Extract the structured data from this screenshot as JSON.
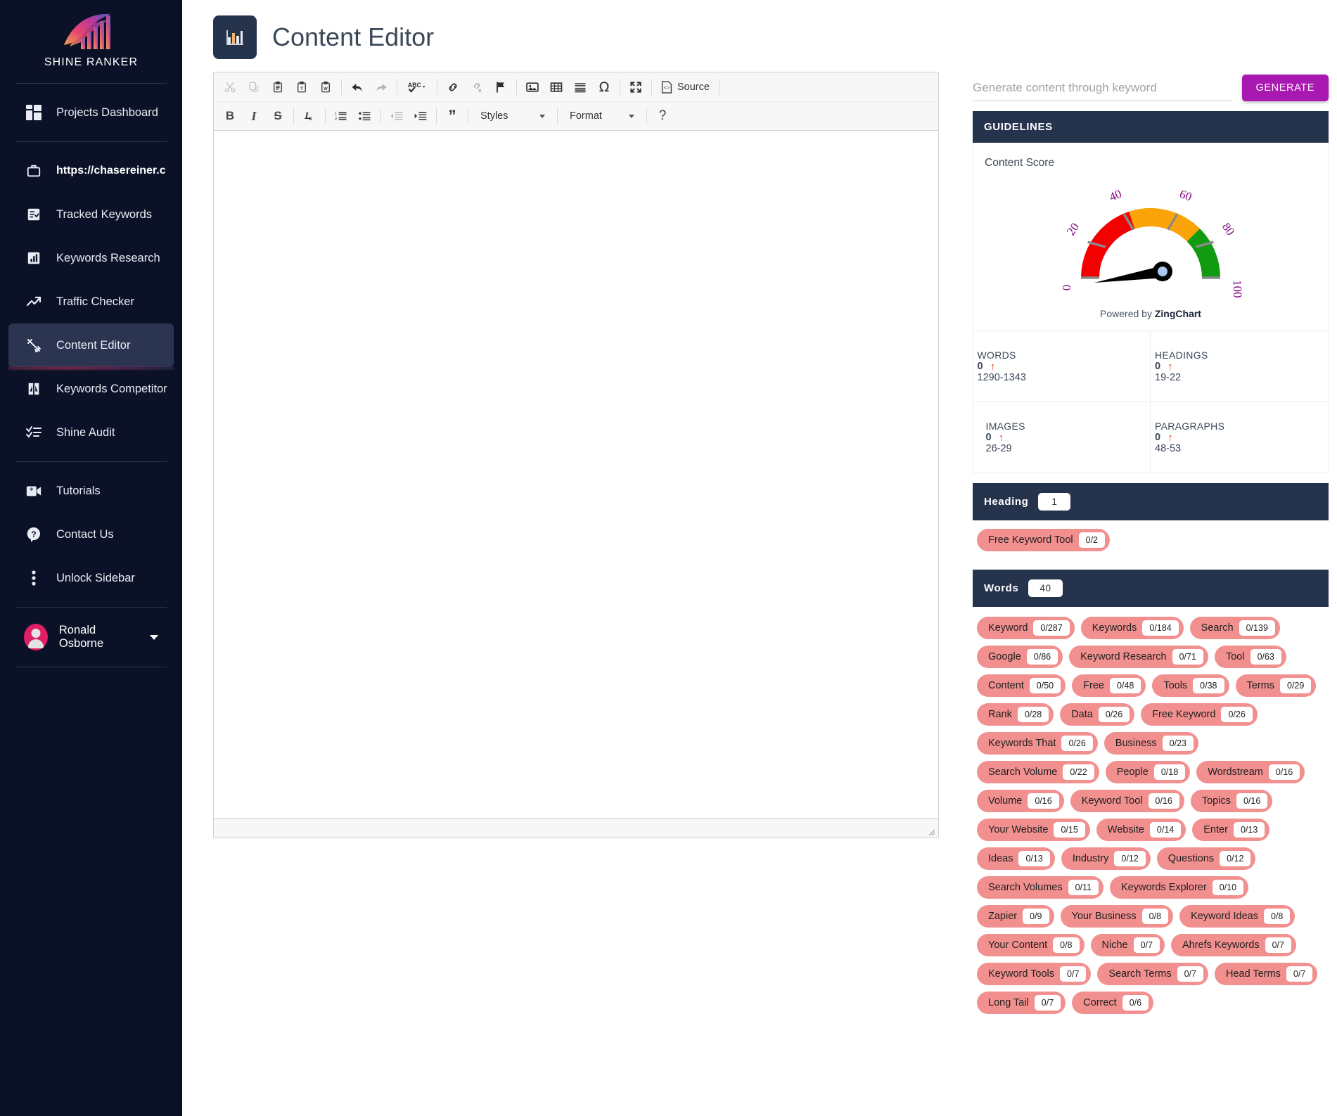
{
  "brand": {
    "name": "SHINE RANKER",
    "logo_icon": "shine-ranker-logo"
  },
  "sidebar": {
    "items": [
      {
        "label": "Projects Dashboard",
        "icon": "dashboard-grid-icon",
        "active": false,
        "bold": false
      },
      {
        "label": "https://chasereiner.c",
        "icon": "briefcase-icon",
        "active": false,
        "bold": true
      },
      {
        "label": "Tracked Keywords",
        "icon": "checklist-icon",
        "active": false,
        "bold": false
      },
      {
        "label": "Keywords Research",
        "icon": "bar-chart-icon",
        "active": false,
        "bold": false
      },
      {
        "label": "Traffic Checker",
        "icon": "trending-up-icon",
        "active": false,
        "bold": false
      },
      {
        "label": "Content Editor",
        "icon": "content-editor-icon",
        "active": true,
        "bold": false
      },
      {
        "label": "Keywords Competitor",
        "icon": "competitor-icon",
        "active": false,
        "bold": false
      },
      {
        "label": "Shine Audit",
        "icon": "audit-checklist-icon",
        "active": false,
        "bold": false
      },
      {
        "label": "Tutorials",
        "icon": "video-icon",
        "active": false,
        "bold": false
      },
      {
        "label": "Contact Us",
        "icon": "question-circle-icon",
        "active": false,
        "bold": false
      },
      {
        "label": "Unlock Sidebar",
        "icon": "dots-vertical-icon",
        "active": false,
        "bold": false
      }
    ],
    "user": {
      "name": "Ronald Osborne",
      "avatar_icon": "user-avatar",
      "caret_icon": "chevron-down-icon",
      "avatar_color": "#e01e63"
    }
  },
  "header": {
    "title": "Content Editor",
    "icon": "bar-chart-page-icon"
  },
  "editor": {
    "toolbar_row1": [
      {
        "name": "cut",
        "glyph": "✂",
        "disabled": true
      },
      {
        "name": "copy",
        "glyph": "copy",
        "disabled": true
      },
      {
        "name": "paste",
        "glyph": "paste",
        "disabled": false
      },
      {
        "name": "paste-as-plain-text",
        "glyph": "paste-text",
        "disabled": false
      },
      {
        "name": "paste-from-word",
        "glyph": "paste-word",
        "disabled": false
      },
      {
        "name": "sep",
        "glyph": "",
        "disabled": false
      },
      {
        "name": "undo",
        "glyph": "undo",
        "disabled": false
      },
      {
        "name": "redo",
        "glyph": "redo",
        "disabled": true
      },
      {
        "name": "sep",
        "glyph": "",
        "disabled": false
      },
      {
        "name": "spell-check",
        "glyph": "abc-check",
        "disabled": false
      },
      {
        "name": "sep",
        "glyph": "",
        "disabled": false
      },
      {
        "name": "link",
        "glyph": "link",
        "disabled": false
      },
      {
        "name": "unlink",
        "glyph": "unlink",
        "disabled": true
      },
      {
        "name": "anchor",
        "glyph": "flag",
        "disabled": false
      },
      {
        "name": "sep",
        "glyph": "",
        "disabled": false
      },
      {
        "name": "image",
        "glyph": "image",
        "disabled": false
      },
      {
        "name": "table",
        "glyph": "table",
        "disabled": false
      },
      {
        "name": "horizontal-rule",
        "glyph": "hrule",
        "disabled": false
      },
      {
        "name": "special-character",
        "glyph": "Ω",
        "disabled": false
      },
      {
        "name": "sep",
        "glyph": "",
        "disabled": false
      },
      {
        "name": "maximize",
        "glyph": "maximize",
        "disabled": false
      }
    ],
    "source_label": "Source",
    "toolbar_row2": [
      {
        "name": "bold",
        "glyph": "B",
        "disabled": false
      },
      {
        "name": "italic",
        "glyph": "I",
        "disabled": false
      },
      {
        "name": "strikethrough",
        "glyph": "S",
        "disabled": false
      },
      {
        "name": "sep",
        "glyph": "",
        "disabled": false
      },
      {
        "name": "remove-format",
        "glyph": "Ix",
        "disabled": false
      },
      {
        "name": "sep",
        "glyph": "",
        "disabled": false
      },
      {
        "name": "numbered-list",
        "glyph": "ol",
        "disabled": false
      },
      {
        "name": "bulleted-list",
        "glyph": "ul",
        "disabled": false
      },
      {
        "name": "sep",
        "glyph": "",
        "disabled": false
      },
      {
        "name": "decrease-indent",
        "glyph": "outdent",
        "disabled": true
      },
      {
        "name": "increase-indent",
        "glyph": "indent",
        "disabled": false
      },
      {
        "name": "sep",
        "glyph": "",
        "disabled": false
      },
      {
        "name": "block-quote",
        "glyph": "”",
        "disabled": false
      }
    ],
    "styles_label": "Styles",
    "format_label": "Format",
    "help_label": "?",
    "body_text": ""
  },
  "right": {
    "generate": {
      "placeholder": "Generate content through keyword",
      "value": "",
      "button_label": "GENERATE",
      "button_color": "#a918b1"
    },
    "guidelines_title": "GUIDELINES",
    "content_score_label": "Content Score",
    "zing_prefix": "Powered by ",
    "zing_name": "ZingChart",
    "metrics": [
      {
        "title": "WORDS",
        "value": "0",
        "arrow": "↑",
        "range": "1290-1343"
      },
      {
        "title": "HEADINGS",
        "value": "0",
        "arrow": "↑",
        "range": "19-22"
      },
      {
        "title": "IMAGES",
        "value": "0",
        "arrow": "↑",
        "range": "26-29"
      },
      {
        "title": "PARAGRAPHS",
        "value": "0",
        "arrow": "↑",
        "range": "48-53"
      }
    ],
    "heading_section": {
      "title": "Heading",
      "count": "1",
      "chips": [
        {
          "label": "Free Keyword Tool",
          "value": "0/2"
        }
      ]
    },
    "words_section": {
      "title": "Words",
      "count": "40",
      "chips": [
        {
          "label": "Keyword",
          "value": "0/287"
        },
        {
          "label": "Keywords",
          "value": "0/184"
        },
        {
          "label": "Search",
          "value": "0/139"
        },
        {
          "label": "Google",
          "value": "0/86"
        },
        {
          "label": "Keyword Research",
          "value": "0/71"
        },
        {
          "label": "Tool",
          "value": "0/63"
        },
        {
          "label": "Content",
          "value": "0/50"
        },
        {
          "label": "Free",
          "value": "0/48"
        },
        {
          "label": "Tools",
          "value": "0/38"
        },
        {
          "label": "Terms",
          "value": "0/29"
        },
        {
          "label": "Rank",
          "value": "0/28"
        },
        {
          "label": "Data",
          "value": "0/26"
        },
        {
          "label": "Free Keyword",
          "value": "0/26"
        },
        {
          "label": "Keywords That",
          "value": "0/26"
        },
        {
          "label": "Business",
          "value": "0/23"
        },
        {
          "label": "Search Volume",
          "value": "0/22"
        },
        {
          "label": "People",
          "value": "0/18"
        },
        {
          "label": "Wordstream",
          "value": "0/16"
        },
        {
          "label": "Volume",
          "value": "0/16"
        },
        {
          "label": "Keyword Tool",
          "value": "0/16"
        },
        {
          "label": "Topics",
          "value": "0/16"
        },
        {
          "label": "Your Website",
          "value": "0/15"
        },
        {
          "label": "Website",
          "value": "0/14"
        },
        {
          "label": "Enter",
          "value": "0/13"
        },
        {
          "label": "Ideas",
          "value": "0/13"
        },
        {
          "label": "Industry",
          "value": "0/12"
        },
        {
          "label": "Questions",
          "value": "0/12"
        },
        {
          "label": "Search Volumes",
          "value": "0/11"
        },
        {
          "label": "Keywords Explorer",
          "value": "0/10"
        },
        {
          "label": "Zapier",
          "value": "0/9"
        },
        {
          "label": "Your Business",
          "value": "0/8"
        },
        {
          "label": "Keyword Ideas",
          "value": "0/8"
        },
        {
          "label": "Your Content",
          "value": "0/8"
        },
        {
          "label": "Niche",
          "value": "0/7"
        },
        {
          "label": "Ahrefs Keywords",
          "value": "0/7"
        },
        {
          "label": "Keyword Tools",
          "value": "0/7"
        },
        {
          "label": "Search Terms",
          "value": "0/7"
        },
        {
          "label": "Head Terms",
          "value": "0/7"
        },
        {
          "label": "Long Tail",
          "value": "0/7"
        },
        {
          "label": "Correct",
          "value": "0/6"
        }
      ]
    }
  },
  "chart_data": {
    "type": "gauge",
    "title": "Content Score",
    "value": 0,
    "min": 0,
    "max": 100,
    "tick_labels": [
      "0",
      "20",
      "40",
      "60",
      "80",
      "100"
    ],
    "tick_color": "#800080",
    "bands": [
      {
        "from": 0,
        "to": 40,
        "color": "#f40000"
      },
      {
        "from": 40,
        "to": 75,
        "color": "#fba40a"
      },
      {
        "from": 75,
        "to": 100,
        "color": "#119b11"
      }
    ],
    "needle_color": "#000000",
    "hub_color": "#a8c9f0",
    "credit": "Powered by ZingChart"
  }
}
